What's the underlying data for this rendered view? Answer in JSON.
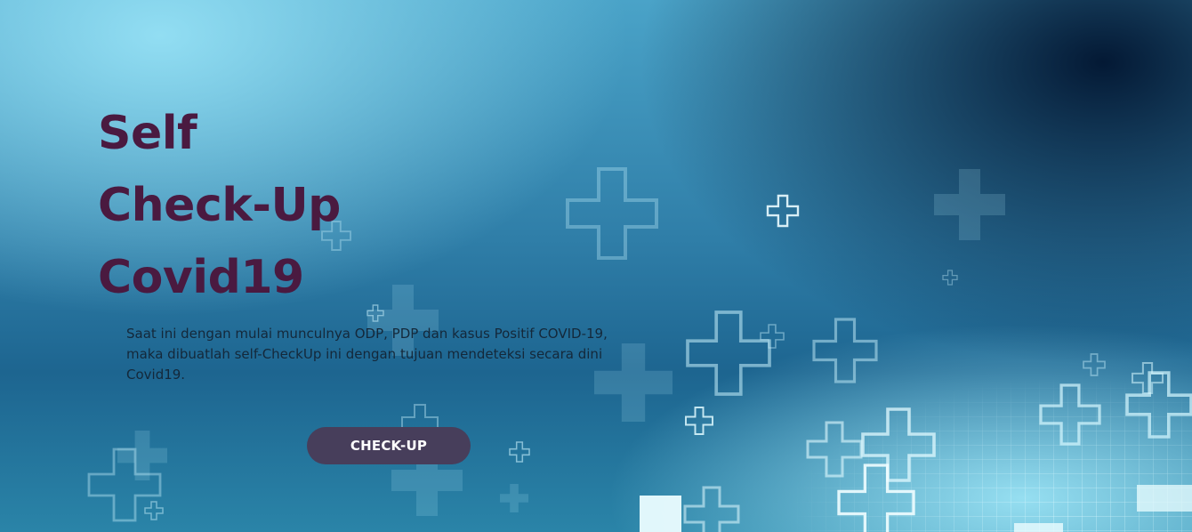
{
  "hero": {
    "title_lines": [
      "Self",
      "Check-Up",
      "Covid19"
    ],
    "description": "Saat ini dengan mulai munculnya ODP, PDP dan kasus Positif COVID-19, maka dibuatlah self-CheckUp ini dengan tujuan mendeteksi secara dini Covid19.",
    "cta_label": "CHECK-UP"
  },
  "colors": {
    "title": "#4a1a40",
    "text": "#14283a",
    "button_bg": "#473e5b",
    "button_text": "#ffffff",
    "bg_light": "#96e1f5",
    "bg_dark": "#00122d"
  },
  "icons": [
    "medical-cross-icon"
  ]
}
